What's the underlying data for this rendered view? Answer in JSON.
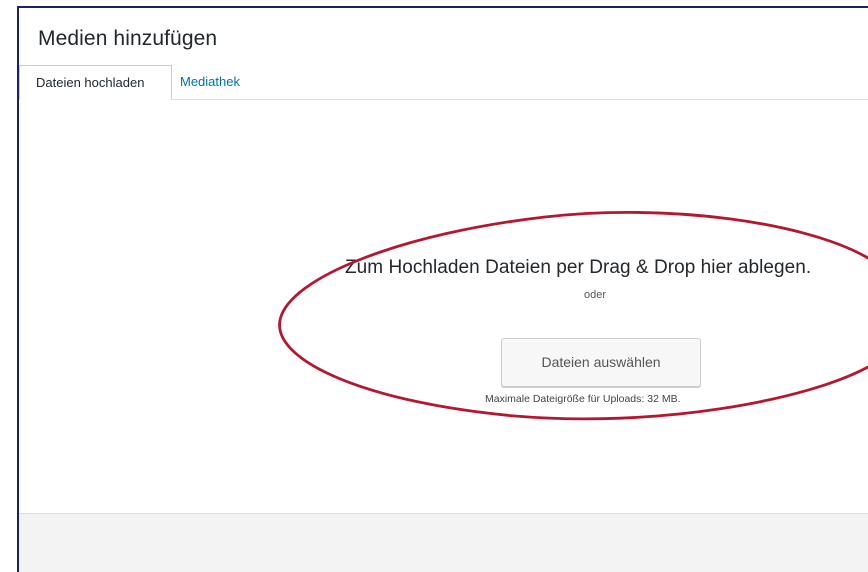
{
  "modal": {
    "title": "Medien hinzufügen"
  },
  "tabs": [
    {
      "label": "Dateien hochladen",
      "active": true
    },
    {
      "label": "Mediathek",
      "active": false
    }
  ],
  "uploader": {
    "instructions": "Zum Hochladen Dateien per Drag & Drop hier ablegen.",
    "or_label": "oder",
    "select_button_label": "Dateien auswählen",
    "max_size_text": "Maximale Dateigröße für Uploads: 32 MB."
  },
  "colors": {
    "link_blue": "#0073aa",
    "frame_navy": "#1f1f6b",
    "annotation_red": "#b5172f"
  }
}
